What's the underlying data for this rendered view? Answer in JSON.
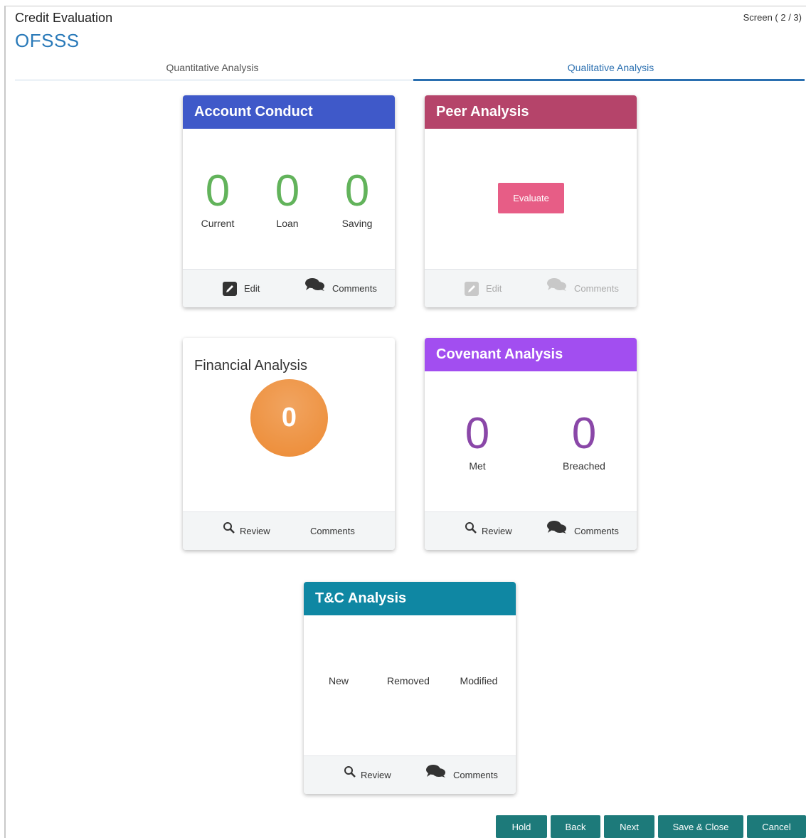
{
  "header": {
    "title": "Credit Evaluation",
    "subtitle": "OFSSS",
    "screen_indicator": "Screen ( 2 / 3)"
  },
  "tabs": [
    {
      "label": "Quantitative Analysis",
      "active": false
    },
    {
      "label": "Qualitative Analysis",
      "active": true
    }
  ],
  "account_conduct": {
    "title": "Account Conduct",
    "color": "#3f59c9",
    "stats": [
      {
        "value": "0",
        "label": "Current"
      },
      {
        "value": "0",
        "label": "Loan"
      },
      {
        "value": "0",
        "label": "Saving"
      }
    ],
    "edit_label": "Edit",
    "comments_label": "Comments"
  },
  "peer_analysis": {
    "title": "Peer Analysis",
    "color": "#b5446a",
    "evaluate_label": "Evaluate",
    "edit_label": "Edit",
    "comments_label": "Comments"
  },
  "financial_analysis": {
    "title": "Financial Analysis",
    "value": "0",
    "review_label": "Review",
    "comments_label": "Comments"
  },
  "covenant_analysis": {
    "title": "Covenant Analysis",
    "color": "#a24ef0",
    "stats": [
      {
        "value": "0",
        "label": "Met"
      },
      {
        "value": "0",
        "label": "Breached"
      }
    ],
    "review_label": "Review",
    "comments_label": "Comments"
  },
  "tc_analysis": {
    "title": "T&C Analysis",
    "color": "#0f87a3",
    "labels": [
      "New",
      "Removed",
      "Modified"
    ],
    "review_label": "Review",
    "comments_label": "Comments"
  },
  "actions": {
    "hold": "Hold",
    "back": "Back",
    "next": "Next",
    "save_close": "Save & Close",
    "cancel": "Cancel"
  }
}
